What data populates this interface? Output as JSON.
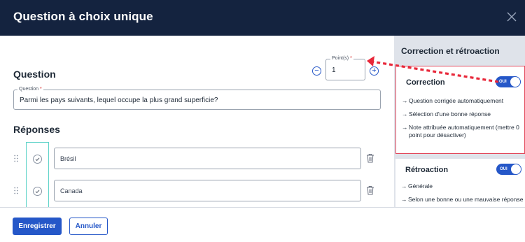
{
  "header": {
    "title": "Question à choix unique",
    "close_icon": "close-icon"
  },
  "question_section": {
    "heading": "Question",
    "points": {
      "label": "Point(s)",
      "required_mark": "*",
      "value": "1",
      "minus_symbol": "−",
      "plus_symbol": "+"
    },
    "question_field": {
      "label": "Question",
      "required_mark": "*",
      "value": "Parmi les pays suivants, lequel occupe la plus grand superficie?"
    }
  },
  "answers_section": {
    "heading": "Réponses",
    "answers": [
      {
        "text": "Brésil",
        "checked": false
      },
      {
        "text": "Canada",
        "checked": false
      }
    ]
  },
  "sidebar": {
    "title": "Correction et rétroaction",
    "correction": {
      "title": "Correction",
      "toggle_label": "OUI",
      "toggle_on": true,
      "items": [
        "Question corrigée automatiquement",
        "Sélection d'une bonne réponse",
        "Note attribuée automatiquement (mettre 0 point pour désactiver)"
      ]
    },
    "retroaction": {
      "title": "Rétroaction",
      "toggle_label": "OUI",
      "toggle_on": true,
      "items": [
        "Générale",
        "Selon une bonne ou une mauvaise réponse"
      ]
    }
  },
  "footer": {
    "save_label": "Enregistrer",
    "cancel_label": "Annuler"
  },
  "colors": {
    "header_bg": "#14233f",
    "accent": "#2557c8",
    "highlight": "#e2485b",
    "answer_column": "#5dd3c8",
    "sidebar_bg": "#dfe3ea"
  }
}
